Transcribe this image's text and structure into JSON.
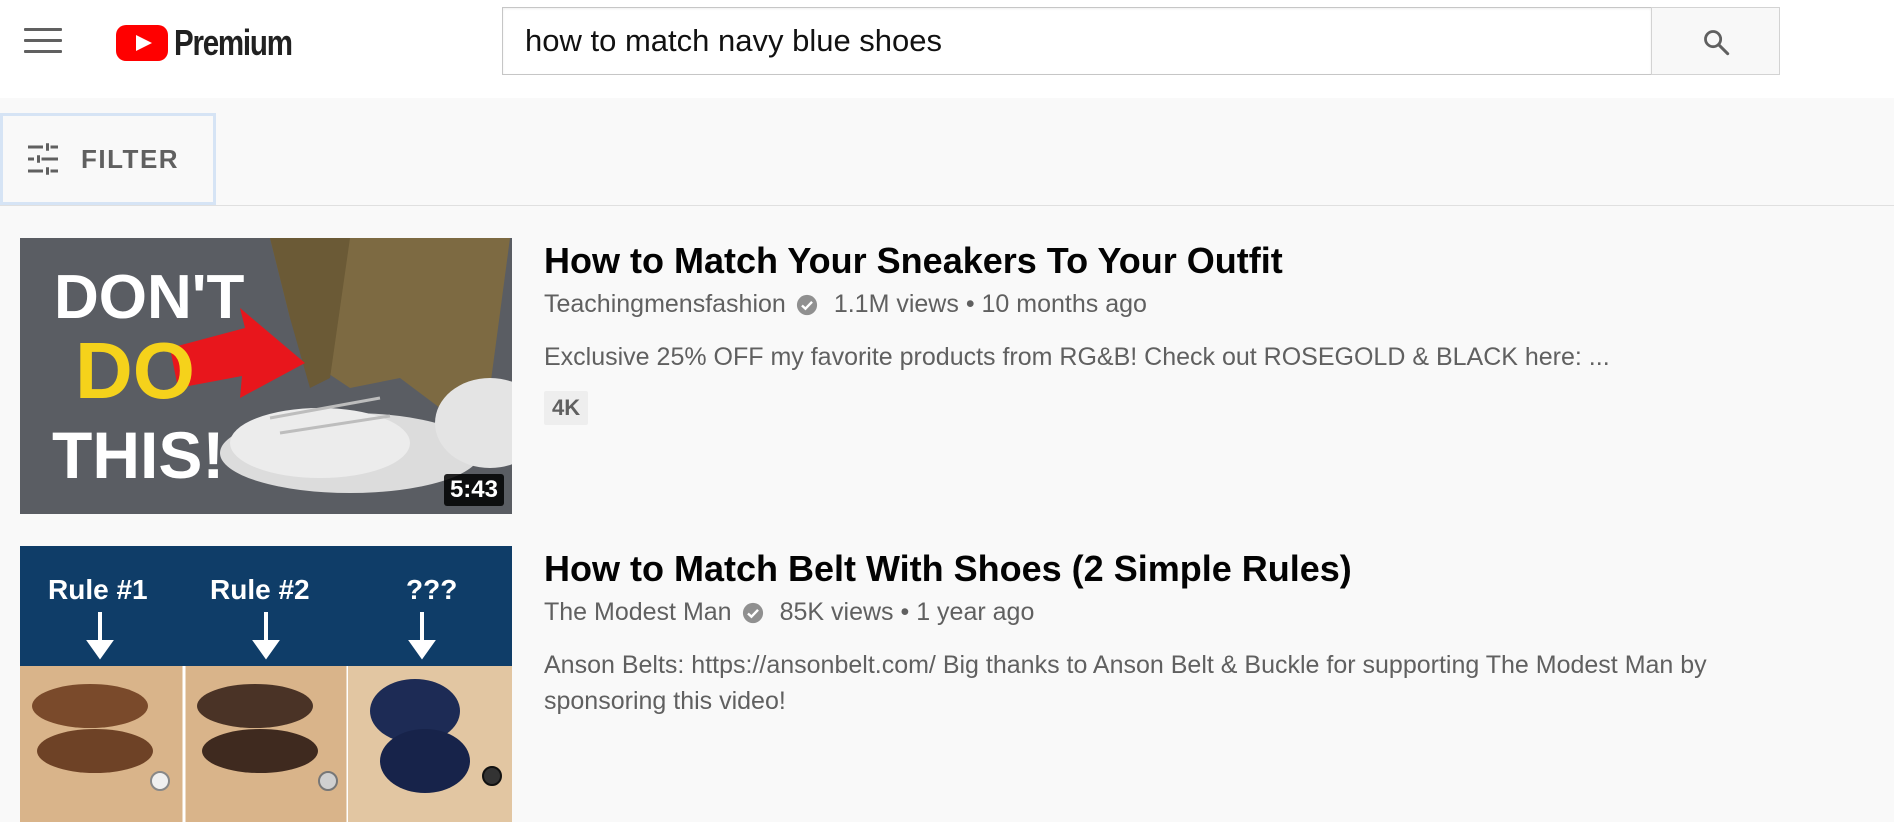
{
  "header": {
    "brand": "Premium",
    "search": {
      "value": "how to match navy blue shoes"
    }
  },
  "filter": {
    "label": "FILTER"
  },
  "results": [
    {
      "title": "How to Match Your Sneakers To Your Outfit",
      "channel": "Teachingmensfashion",
      "views": "1.1M views",
      "age": "10 months ago",
      "description": "Exclusive 25% OFF my favorite products from RG&B! Check out ROSEGOLD & BLACK here: ...",
      "badge": "4K",
      "duration": "5:43",
      "thumb_text": {
        "line1": "DON'T",
        "line2": "DO",
        "line3": "THIS!"
      }
    },
    {
      "title": "How to Match Belt With Shoes (2 Simple Rules)",
      "channel": "The Modest Man",
      "views": "85K views",
      "age": "1 year ago",
      "description": "Anson Belts: https://ansonbelt.com/ Big thanks to Anson Belt & Buckle for supporting The Modest Man by sponsoring this video!",
      "thumb_text": {
        "rule1": "Rule #1",
        "rule2": "Rule #2",
        "rule3": "???"
      }
    }
  ],
  "colors": {
    "accent": "#ff0000",
    "thumb1_bg": "#5a5d63",
    "thumb2_bg": "#0f3d68",
    "yellow": "#f5d21b"
  }
}
